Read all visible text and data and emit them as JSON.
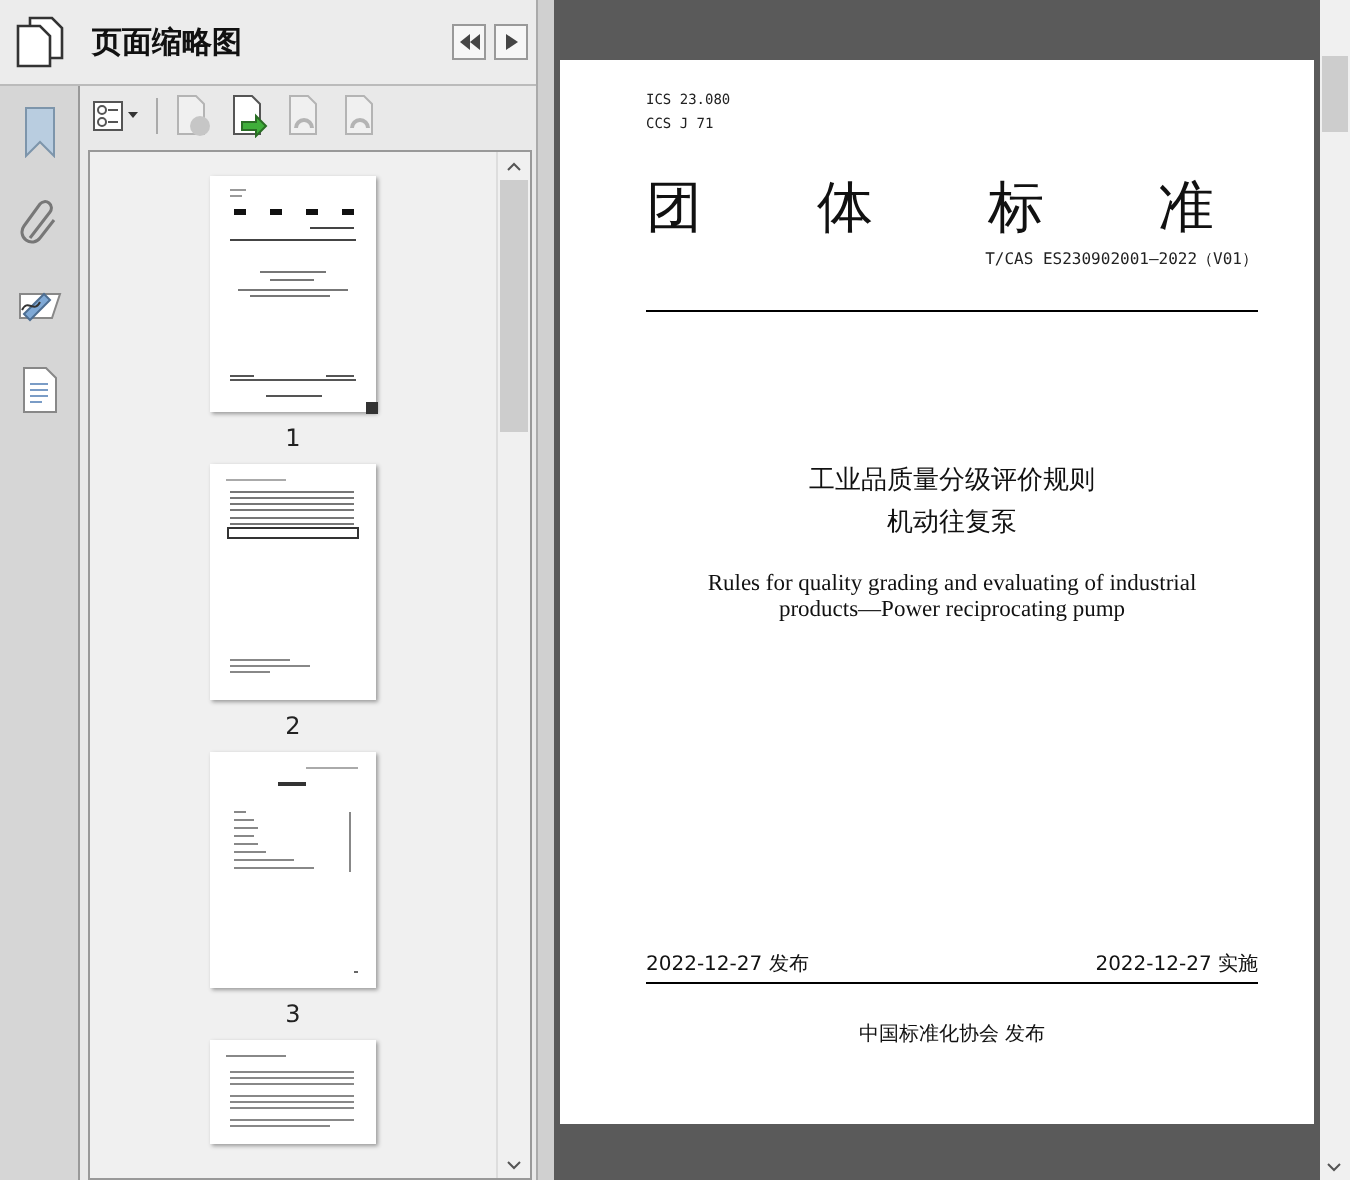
{
  "panel": {
    "title": "页面缩略图"
  },
  "toolbar": [
    {
      "kind": "options",
      "disabled": false
    },
    {
      "kind": "delete",
      "disabled": true
    },
    {
      "kind": "insert",
      "disabled": false
    },
    {
      "kind": "undo",
      "disabled": true
    },
    {
      "kind": "redo",
      "disabled": true
    }
  ],
  "thumbnails": [
    {
      "label": "1",
      "selected": true
    },
    {
      "label": "2",
      "selected": false
    },
    {
      "label": "3",
      "selected": false
    }
  ],
  "page": {
    "ics": "ICS 23.080",
    "ccs": "CCS J 71",
    "heading": "团体标准",
    "code": "T/CAS ES230902001—2022（V01）",
    "title_lines": [
      "工业品质量分级评价规则",
      "机动往复泵"
    ],
    "english": "Rules for quality grading and evaluating of industrial products—Power reciprocating pump",
    "issue_date": "2022-12-27 发布",
    "effective_date": "2022-12-27 实施",
    "publisher": "中国标准化协会 发布"
  }
}
